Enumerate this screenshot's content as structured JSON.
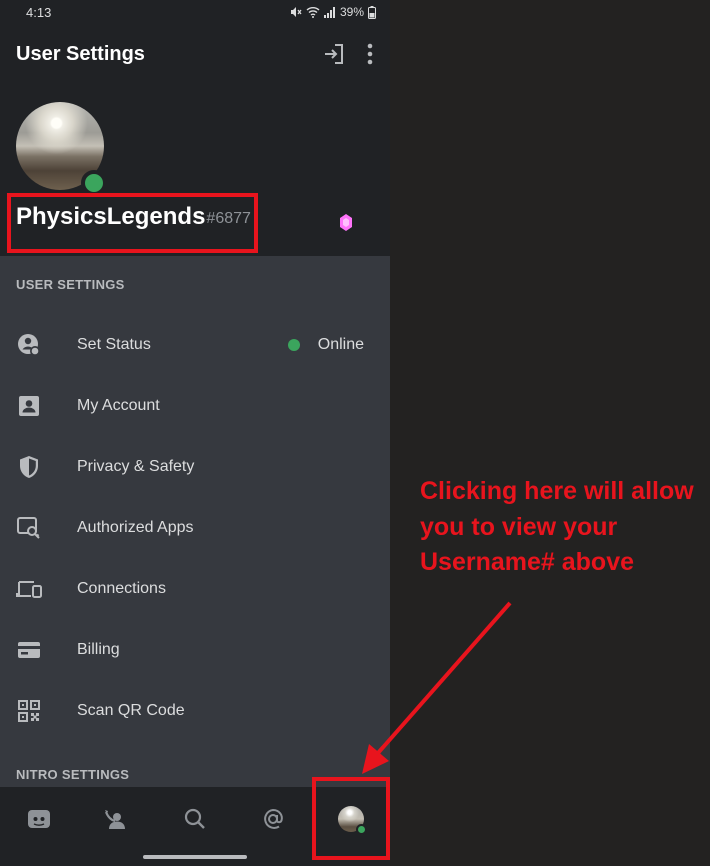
{
  "status_bar": {
    "time": "4:13",
    "battery": "39%"
  },
  "app_bar": {
    "title": "User Settings"
  },
  "profile": {
    "username": "PhysicsLegends",
    "discriminator": "#6877"
  },
  "user_settings": {
    "header": "USER SETTINGS",
    "items": [
      {
        "label": "Set Status",
        "icon": "set-status-icon",
        "trailing": "Online"
      },
      {
        "label": "My Account",
        "icon": "account-icon"
      },
      {
        "label": "Privacy & Safety",
        "icon": "shield-icon"
      },
      {
        "label": "Authorized Apps",
        "icon": "authorized-apps-icon"
      },
      {
        "label": "Connections",
        "icon": "devices-icon"
      },
      {
        "label": "Billing",
        "icon": "credit-card-icon"
      },
      {
        "label": "Scan QR Code",
        "icon": "qr-code-icon"
      }
    ]
  },
  "nitro_settings": {
    "header": "NITRO SETTINGS"
  },
  "bottom_tabs": [
    "home",
    "friends",
    "search",
    "mentions",
    "profile"
  ],
  "annotation": {
    "text": "Clicking here will allow\nyou to view your\nUsername# above"
  },
  "colors": {
    "background": "#36393f",
    "header_background": "#202225",
    "online_green": "#3ba55d",
    "annotation_red": "#e8141d",
    "nitro_gem": "#ff73fa"
  }
}
